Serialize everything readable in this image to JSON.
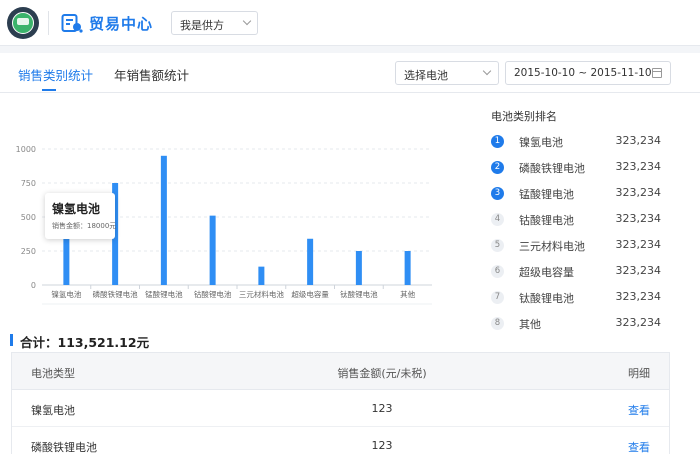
{
  "header": {
    "app_title": "贸易中心",
    "role_select": "我是供方"
  },
  "tabs": [
    {
      "label": "销售类别统计",
      "active": true
    },
    {
      "label": "年销售额统计",
      "active": false
    }
  ],
  "filters": {
    "battery_select": "选择电池",
    "date_range": "2015-10-10 ~ 2015-11-10"
  },
  "chart_data": {
    "type": "bar",
    "categories": [
      "镍氢电池",
      "磷酸铁锂电池",
      "锰酸锂电池",
      "钴酸锂电池",
      "三元材料电池",
      "超级电容量",
      "钛酸锂电池",
      "其他"
    ],
    "values": [
      400,
      750,
      950,
      510,
      135,
      340,
      250,
      250
    ],
    "ylim": [
      0,
      1000
    ],
    "yticks": [
      0,
      250,
      500,
      750,
      1000
    ],
    "grid": true,
    "bar_color": "#2f8ef4"
  },
  "tooltip": {
    "title": "镍氢电池",
    "detail": "销售金额：18000元"
  },
  "ranking": {
    "title": "电池类别排名",
    "items": [
      {
        "rank": "1",
        "name": "镍氢电池",
        "value": "323,234"
      },
      {
        "rank": "2",
        "name": "磷酸铁锂电池",
        "value": "323,234"
      },
      {
        "rank": "3",
        "name": "锰酸锂电池",
        "value": "323,234"
      },
      {
        "rank": "4",
        "name": "钴酸锂电池",
        "value": "323,234"
      },
      {
        "rank": "5",
        "name": "三元材料电池",
        "value": "323,234"
      },
      {
        "rank": "6",
        "name": "超级电容量",
        "value": "323,234"
      },
      {
        "rank": "7",
        "name": "钛酸锂电池",
        "value": "323,234"
      },
      {
        "rank": "8",
        "name": "其他",
        "value": "323,234"
      }
    ]
  },
  "total": "合计：113,521.12元",
  "table": {
    "headers": [
      "电池类型",
      "销售金额(元/未税)",
      "明细"
    ],
    "rows": [
      {
        "type": "镍氢电池",
        "amount": "123",
        "action": "查看"
      },
      {
        "type": "磷酸铁锂电池",
        "amount": "123",
        "action": "查看"
      }
    ]
  },
  "colors": {
    "accent": "#1f7bea"
  }
}
